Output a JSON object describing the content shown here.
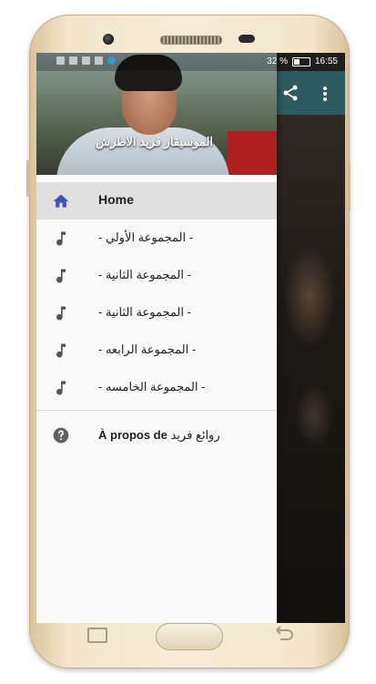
{
  "status_bar": {
    "battery_percent": "32 %",
    "time": "16:55"
  },
  "drawer": {
    "header_title": "الموسيقار فريد الاطرش",
    "items": [
      {
        "label": "Home",
        "icon": "home-icon",
        "active": true
      },
      {
        "label": "- المجموعة الأولي -",
        "icon": "music-note-icon",
        "active": false
      },
      {
        "label": "- المجموعة الثانية -",
        "icon": "music-note-icon",
        "active": false
      },
      {
        "label": "- المجموعة الثانية -",
        "icon": "music-note-icon",
        "active": false
      },
      {
        "label": "- المجموعة الرابعه -",
        "icon": "music-note-icon",
        "active": false
      },
      {
        "label": "- المجموعة الخامسه -",
        "icon": "music-note-icon",
        "active": false
      }
    ],
    "about": {
      "prefix": "À propos de",
      "app_name": "روائع فريد",
      "icon": "help-icon"
    }
  },
  "app_bar": {
    "actions": [
      "share-icon",
      "more-vert-icon"
    ]
  },
  "colors": {
    "accent": "#3f51b5",
    "app_bar": "#2e5a62",
    "drawer_active": "#e0e0e0"
  }
}
